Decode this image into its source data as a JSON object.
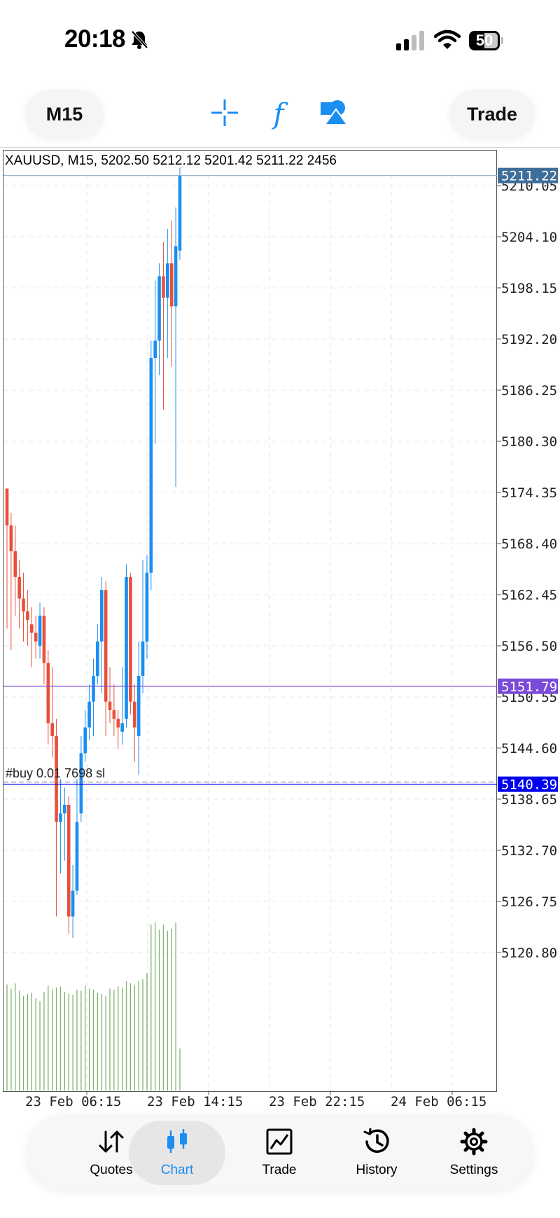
{
  "status_bar": {
    "time": "20:18",
    "battery": "50"
  },
  "toolbar": {
    "timeframe": "M15",
    "trade_label": "Trade"
  },
  "chart": {
    "ohlc_label": "XAUUSD, M15, 5202.50 5212.12 5201.42 5211.22 2456",
    "price_axis": [
      "5210.05",
      "5204.10",
      "5198.15",
      "5192.20",
      "5186.25",
      "5180.30",
      "5174.35",
      "5168.40",
      "5162.45",
      "5156.50",
      "5150.55",
      "5144.60",
      "5138.65",
      "5132.70",
      "5126.75",
      "5120.80"
    ],
    "time_axis": [
      "23 Feb 06:15",
      "23 Feb 14:15",
      "23 Feb 22:15",
      "24 Feb 06:15"
    ],
    "current_price": "5211.22",
    "line_price": "5151.79",
    "order_price": "5140.39",
    "order_text": "#buy 0.01 7698 sl",
    "colors": {
      "bull": "#1a8ef2",
      "bear": "#e8503a",
      "volume": "#7cb46b",
      "current": "#3e6e99",
      "level": "#7b4bd9",
      "order": "#0000ee"
    }
  },
  "nav": {
    "items": [
      {
        "label": "Quotes",
        "icon": "quotes-arrows-icon"
      },
      {
        "label": "Chart",
        "icon": "chart-candles-icon",
        "active": true
      },
      {
        "label": "Trade",
        "icon": "trade-chart-icon"
      },
      {
        "label": "History",
        "icon": "history-clock-icon"
      },
      {
        "label": "Settings",
        "icon": "settings-gear-icon"
      }
    ]
  }
}
